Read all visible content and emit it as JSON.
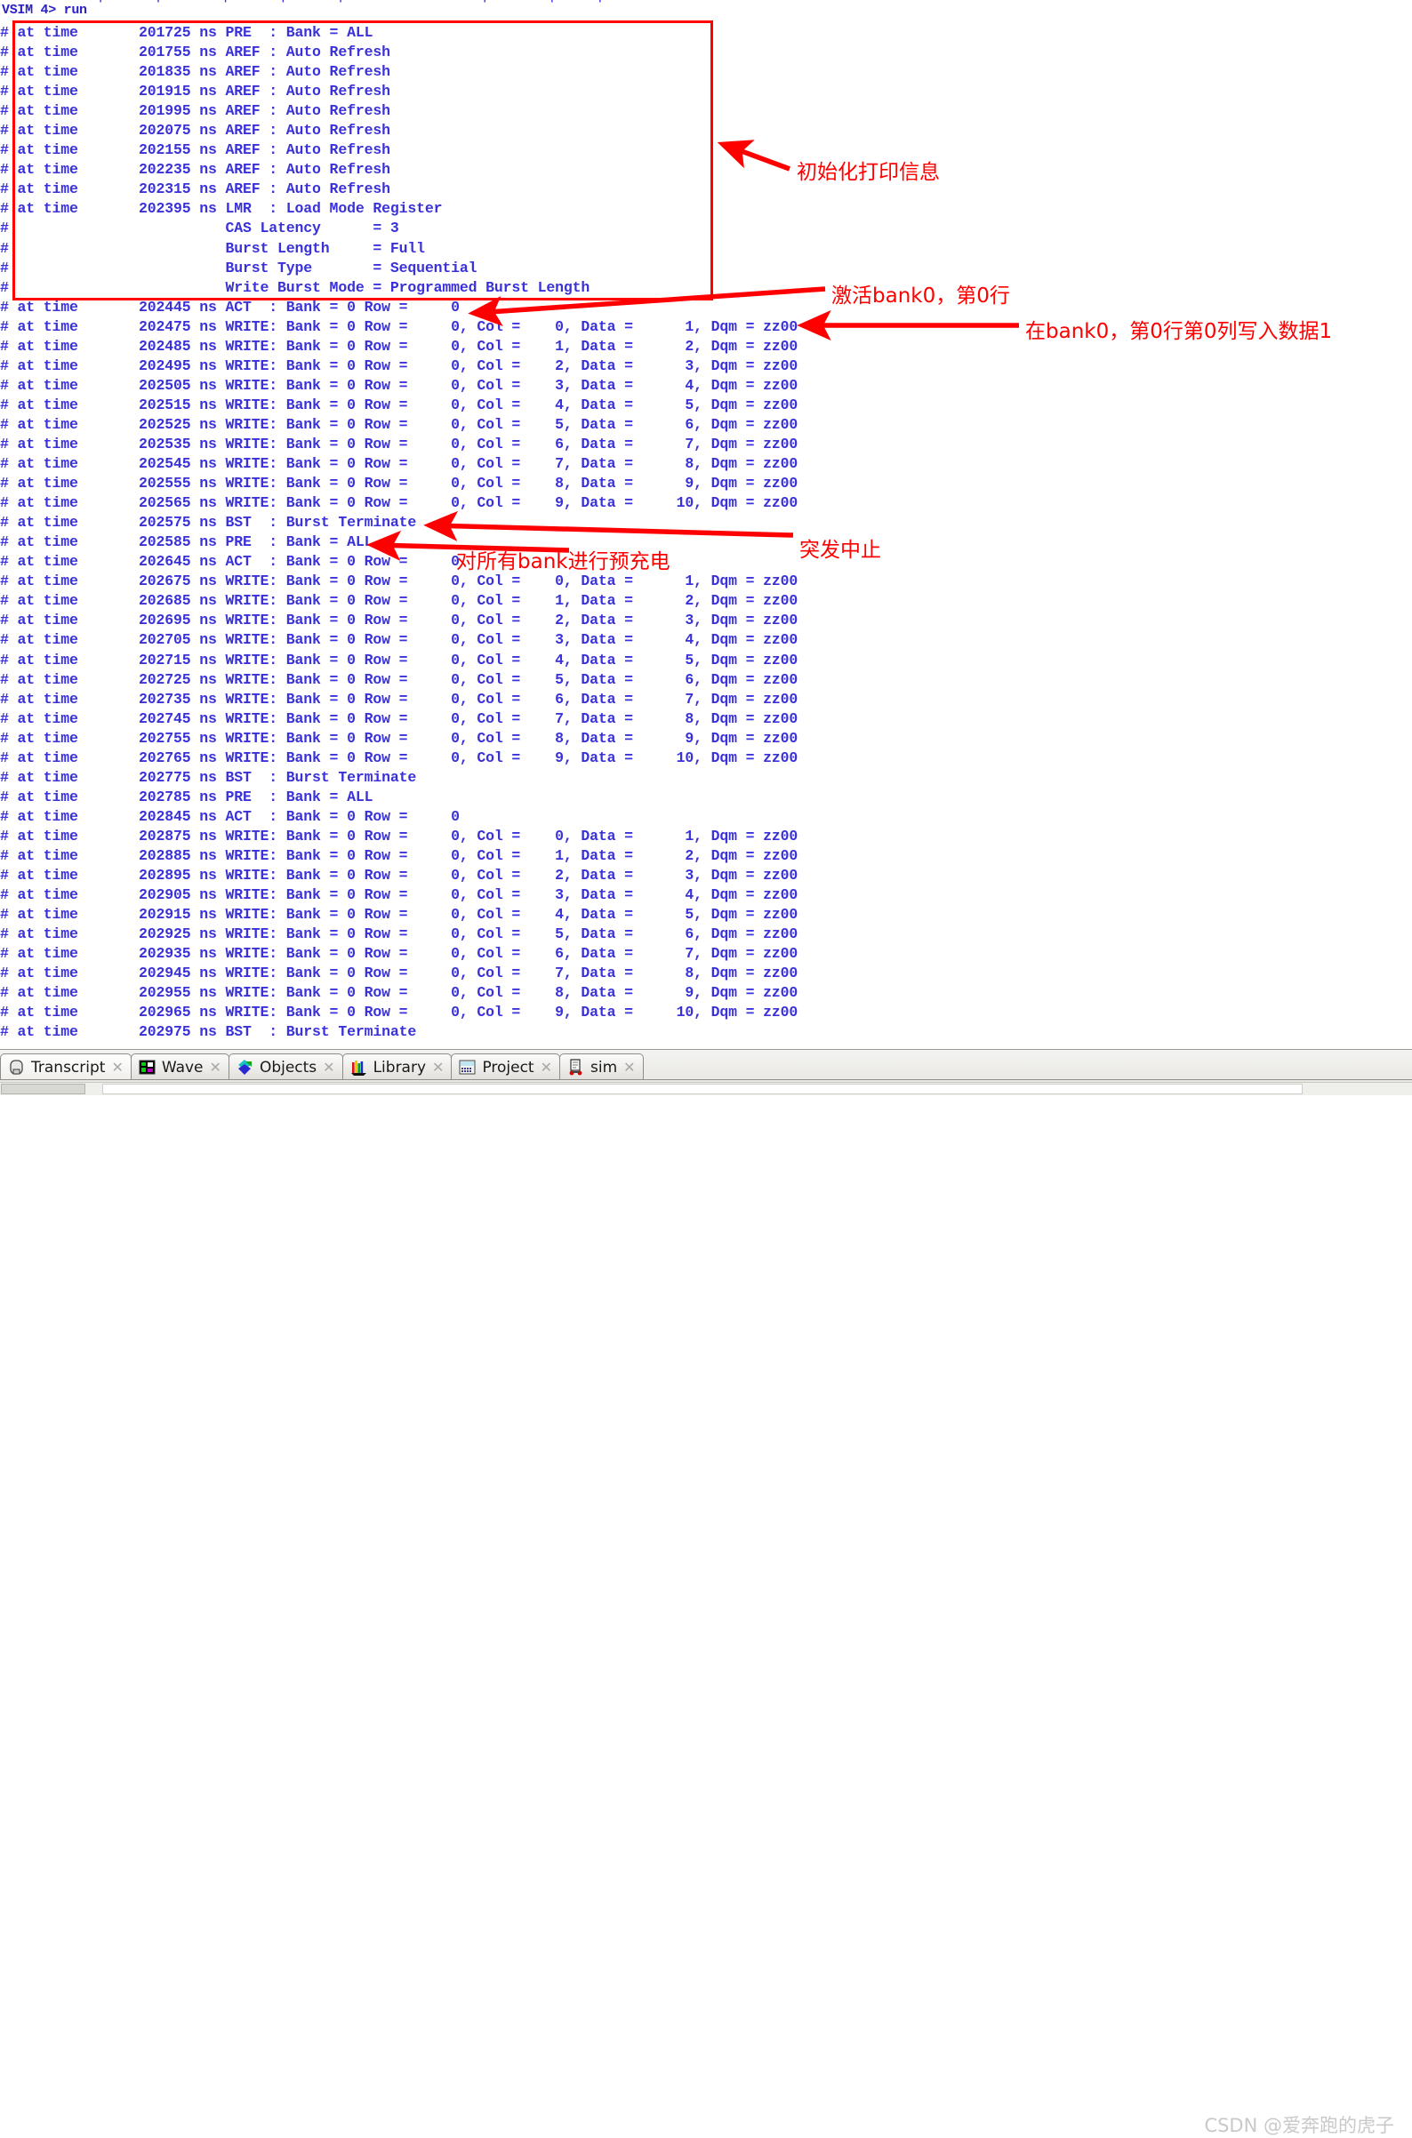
{
  "console": {
    "prompt": "VSIM 4> run",
    "cut_top_fragment": "          |     |      |     |     |              |      |    |",
    "lines": [
      "# at time       201725 ns PRE  : Bank = ALL",
      "# at time       201755 ns AREF : Auto Refresh",
      "# at time       201835 ns AREF : Auto Refresh",
      "# at time       201915 ns AREF : Auto Refresh",
      "# at time       201995 ns AREF : Auto Refresh",
      "# at time       202075 ns AREF : Auto Refresh",
      "# at time       202155 ns AREF : Auto Refresh",
      "# at time       202235 ns AREF : Auto Refresh",
      "# at time       202315 ns AREF : Auto Refresh",
      "# at time       202395 ns LMR  : Load Mode Register",
      "#                         CAS Latency      = 3",
      "#                         Burst Length     = Full",
      "#                         Burst Type       = Sequential",
      "#                         Write Burst Mode = Programmed Burst Length",
      "# at time       202445 ns ACT  : Bank = 0 Row =     0",
      "# at time       202475 ns WRITE: Bank = 0 Row =     0, Col =    0, Data =      1, Dqm = zz00",
      "# at time       202485 ns WRITE: Bank = 0 Row =     0, Col =    1, Data =      2, Dqm = zz00",
      "# at time       202495 ns WRITE: Bank = 0 Row =     0, Col =    2, Data =      3, Dqm = zz00",
      "# at time       202505 ns WRITE: Bank = 0 Row =     0, Col =    3, Data =      4, Dqm = zz00",
      "# at time       202515 ns WRITE: Bank = 0 Row =     0, Col =    4, Data =      5, Dqm = zz00",
      "# at time       202525 ns WRITE: Bank = 0 Row =     0, Col =    5, Data =      6, Dqm = zz00",
      "# at time       202535 ns WRITE: Bank = 0 Row =     0, Col =    6, Data =      7, Dqm = zz00",
      "# at time       202545 ns WRITE: Bank = 0 Row =     0, Col =    7, Data =      8, Dqm = zz00",
      "# at time       202555 ns WRITE: Bank = 0 Row =     0, Col =    8, Data =      9, Dqm = zz00",
      "# at time       202565 ns WRITE: Bank = 0 Row =     0, Col =    9, Data =     10, Dqm = zz00",
      "# at time       202575 ns BST  : Burst Terminate",
      "# at time       202585 ns PRE  : Bank = ALL",
      "# at time       202645 ns ACT  : Bank = 0 Row =     0",
      "# at time       202675 ns WRITE: Bank = 0 Row =     0, Col =    0, Data =      1, Dqm = zz00",
      "# at time       202685 ns WRITE: Bank = 0 Row =     0, Col =    1, Data =      2, Dqm = zz00",
      "# at time       202695 ns WRITE: Bank = 0 Row =     0, Col =    2, Data =      3, Dqm = zz00",
      "# at time       202705 ns WRITE: Bank = 0 Row =     0, Col =    3, Data =      4, Dqm = zz00",
      "# at time       202715 ns WRITE: Bank = 0 Row =     0, Col =    4, Data =      5, Dqm = zz00",
      "# at time       202725 ns WRITE: Bank = 0 Row =     0, Col =    5, Data =      6, Dqm = zz00",
      "# at time       202735 ns WRITE: Bank = 0 Row =     0, Col =    6, Data =      7, Dqm = zz00",
      "# at time       202745 ns WRITE: Bank = 0 Row =     0, Col =    7, Data =      8, Dqm = zz00",
      "# at time       202755 ns WRITE: Bank = 0 Row =     0, Col =    8, Data =      9, Dqm = zz00",
      "# at time       202765 ns WRITE: Bank = 0 Row =     0, Col =    9, Data =     10, Dqm = zz00",
      "# at time       202775 ns BST  : Burst Terminate",
      "# at time       202785 ns PRE  : Bank = ALL",
      "# at time       202845 ns ACT  : Bank = 0 Row =     0",
      "# at time       202875 ns WRITE: Bank = 0 Row =     0, Col =    0, Data =      1, Dqm = zz00",
      "# at time       202885 ns WRITE: Bank = 0 Row =     0, Col =    1, Data =      2, Dqm = zz00",
      "# at time       202895 ns WRITE: Bank = 0 Row =     0, Col =    2, Data =      3, Dqm = zz00",
      "# at time       202905 ns WRITE: Bank = 0 Row =     0, Col =    3, Data =      4, Dqm = zz00",
      "# at time       202915 ns WRITE: Bank = 0 Row =     0, Col =    4, Data =      5, Dqm = zz00",
      "# at time       202925 ns WRITE: Bank = 0 Row =     0, Col =    5, Data =      6, Dqm = zz00",
      "# at time       202935 ns WRITE: Bank = 0 Row =     0, Col =    6, Data =      7, Dqm = zz00",
      "# at time       202945 ns WRITE: Bank = 0 Row =     0, Col =    7, Data =      8, Dqm = zz00",
      "# at time       202955 ns WRITE: Bank = 0 Row =     0, Col =    8, Data =      9, Dqm = zz00",
      "# at time       202965 ns WRITE: Bank = 0 Row =     0, Col =    9, Data =     10, Dqm = zz00",
      "# at time       202975 ns BST  : Burst Terminate"
    ],
    "text_color": "#3a32d8"
  },
  "annotations": {
    "color": "#ff0000",
    "box_color": "#fe0000",
    "items": [
      {
        "id": "init-print-info",
        "text": "初始化打印信息"
      },
      {
        "id": "activate-bank0",
        "text": "激活bank0，第0行"
      },
      {
        "id": "write-data1",
        "text": "在bank0，第0行第0列写入数据1"
      },
      {
        "id": "precharge-all",
        "text": "对所有bank进行预充电"
      },
      {
        "id": "burst-terminate",
        "text": "突发中止"
      }
    ]
  },
  "tabbar": {
    "tabs": [
      {
        "label": "Transcript",
        "icon": "transcript-icon",
        "active": true
      },
      {
        "label": "Wave",
        "icon": "wave-icon",
        "active": false
      },
      {
        "label": "Objects",
        "icon": "objects-icon",
        "active": false
      },
      {
        "label": "Library",
        "icon": "library-icon",
        "active": false
      },
      {
        "label": "Project",
        "icon": "project-icon",
        "active": false
      },
      {
        "label": "sim",
        "icon": "sim-icon",
        "active": false
      }
    ],
    "close_glyph": "✕"
  },
  "watermark": {
    "text": "CSDN @爱奔跑的虎子"
  }
}
